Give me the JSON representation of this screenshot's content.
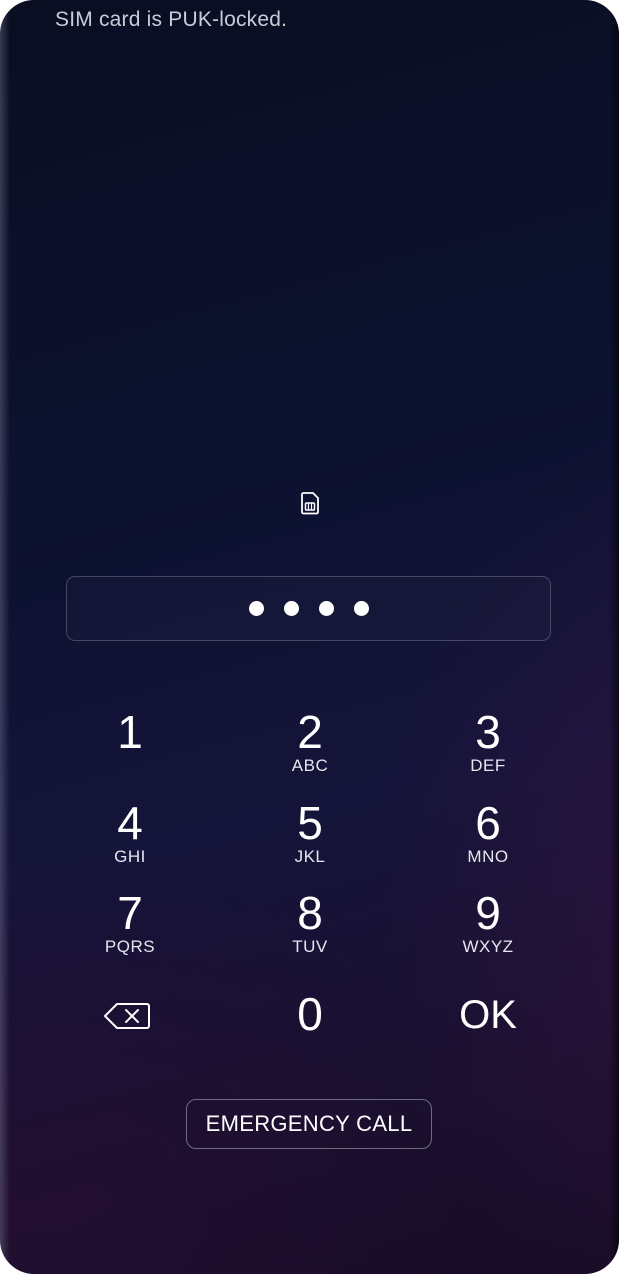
{
  "status": {
    "message": "SIM card is PUK-locked."
  },
  "icons": {
    "sim": "sim-card-icon",
    "backspace": "backspace-icon"
  },
  "pin_entry": {
    "entered_count": 4
  },
  "keypad": {
    "k1": {
      "digit": "1",
      "letters": ""
    },
    "k2": {
      "digit": "2",
      "letters": "ABC"
    },
    "k3": {
      "digit": "3",
      "letters": "DEF"
    },
    "k4": {
      "digit": "4",
      "letters": "GHI"
    },
    "k5": {
      "digit": "5",
      "letters": "JKL"
    },
    "k6": {
      "digit": "6",
      "letters": "MNO"
    },
    "k7": {
      "digit": "7",
      "letters": "PQRS"
    },
    "k8": {
      "digit": "8",
      "letters": "TUV"
    },
    "k9": {
      "digit": "9",
      "letters": "WXYZ"
    },
    "k0": {
      "digit": "0"
    },
    "ok": {
      "label": "OK"
    }
  },
  "emergency": {
    "label": "EMERGENCY CALL"
  },
  "colors": {
    "background_top": "#0a0e22",
    "background_bottom": "#170c26",
    "text": "#ffffff",
    "status_text": "#c9ccd6"
  }
}
